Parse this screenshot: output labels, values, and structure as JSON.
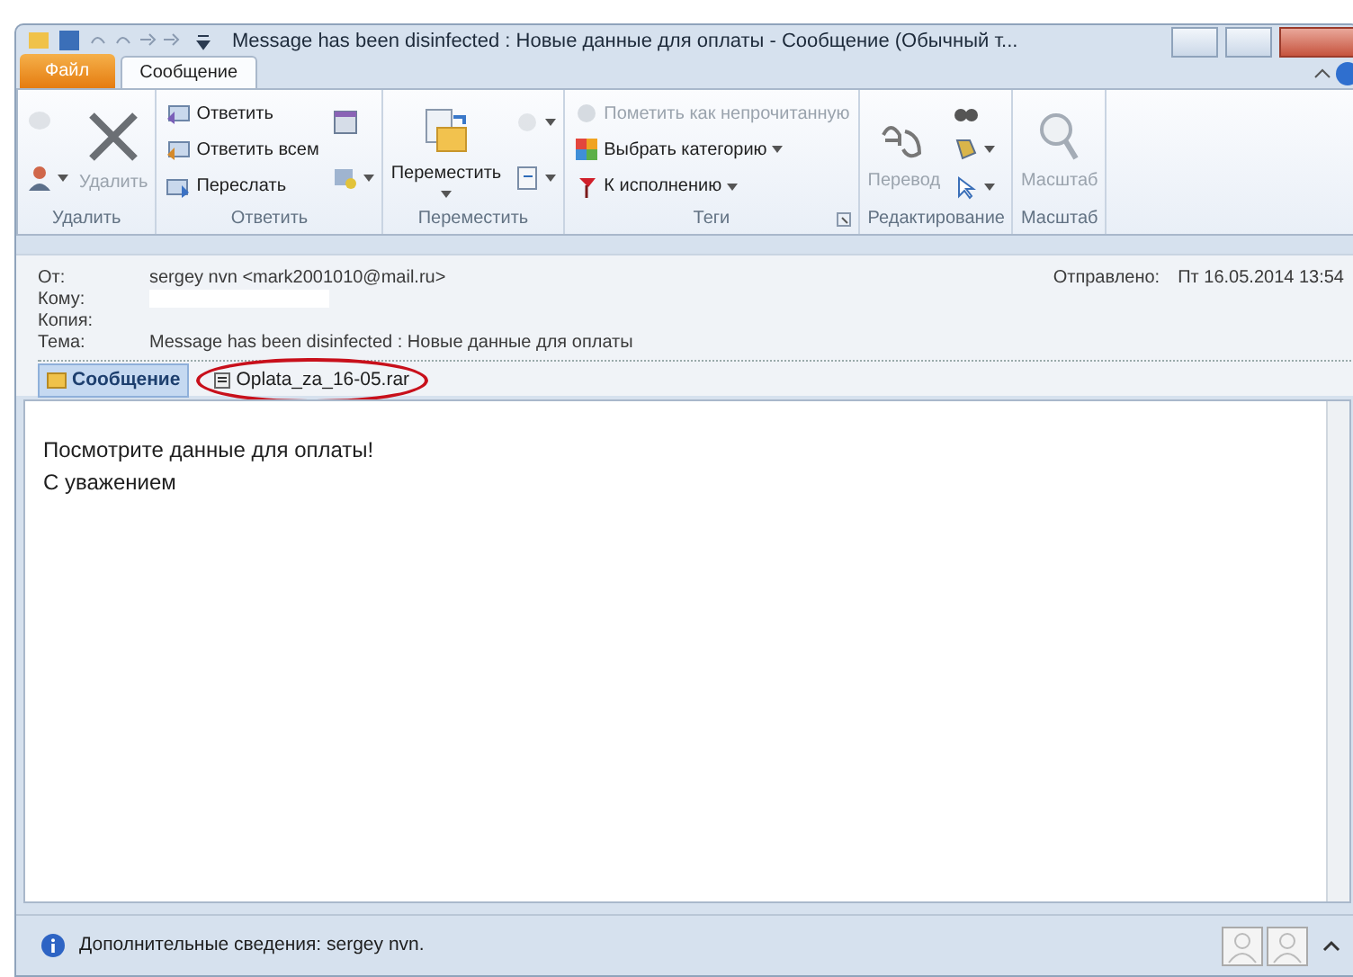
{
  "window": {
    "title": "Message has been disinfected : Новые данные для оплаты - Сообщение (Обычный т..."
  },
  "tabs": [
    {
      "label": "Файл",
      "kind": "file",
      "selected": false
    },
    {
      "label": "Сообщение",
      "kind": "ribbon",
      "selected": true
    }
  ],
  "ribbon": [
    {
      "label": "Удалить",
      "columns": [
        [
          {
            "kind": "icon",
            "disabled": true
          },
          {
            "kind": "icon",
            "dropdown": true
          }
        ],
        [
          {
            "kind": "large",
            "label": "Удалить",
            "disabled": true
          }
        ]
      ]
    },
    {
      "label": "Ответить",
      "columns": [
        [
          {
            "kind": "small",
            "label": "Ответить"
          },
          {
            "kind": "small",
            "label": "Ответить всем"
          },
          {
            "kind": "small",
            "label": "Переслать"
          }
        ],
        [
          {
            "kind": "icon"
          },
          {
            "kind": "icon",
            "dropdown": true
          }
        ]
      ]
    },
    {
      "label": "Переместить",
      "columns": [
        [
          {
            "kind": "large",
            "label": "Переместить",
            "dropdown": true
          }
        ],
        [
          {
            "kind": "icon",
            "dropdown": true,
            "disabled": true
          },
          {
            "kind": "icon",
            "dropdown": true
          }
        ]
      ]
    },
    {
      "label": "Теги",
      "launcher": true,
      "columns": [
        [
          {
            "kind": "small",
            "label": "Пометить как непрочитанную",
            "disabled": true
          },
          {
            "kind": "small",
            "label": "Выбрать категорию",
            "dropdown": true
          },
          {
            "kind": "small",
            "label": "К исполнению",
            "dropdown": true
          }
        ]
      ]
    },
    {
      "label": "Редактирование",
      "columns": [
        [
          {
            "kind": "large",
            "label": "Перевод",
            "disabled": true
          }
        ],
        [
          {
            "kind": "icon"
          },
          {
            "kind": "icon",
            "dropdown": true
          },
          {
            "kind": "icon",
            "dropdown": true
          }
        ]
      ]
    },
    {
      "label": "Масштаб",
      "columns": [
        [
          {
            "kind": "large",
            "label": "Масштаб",
            "disabled": true
          }
        ]
      ]
    }
  ],
  "header": {
    "fields": [
      {
        "label": "От:",
        "value": "sergey nvn <mark2001010@mail.ru>"
      },
      {
        "label": "Кому:",
        "redacted": true
      },
      {
        "label": "Копия:"
      },
      {
        "label": "Тема:",
        "value": "Message has been disinfected : Новые данные для оплаты"
      }
    ],
    "sent_label": "Отправлено:",
    "sent_value": "Пт 16.05.2014 13:54"
  },
  "attachments": [
    {
      "label": "Сообщение",
      "kind": "message",
      "selected": true,
      "circled": false
    },
    {
      "label": "Oplata_za_16-05.rar",
      "kind": "file",
      "selected": false,
      "circled": true
    }
  ],
  "body": [
    "Посмотрите данные для оплаты!",
    "С уважением"
  ],
  "status_bar": {
    "text": "Дополнительные сведения: sergey nvn."
  }
}
